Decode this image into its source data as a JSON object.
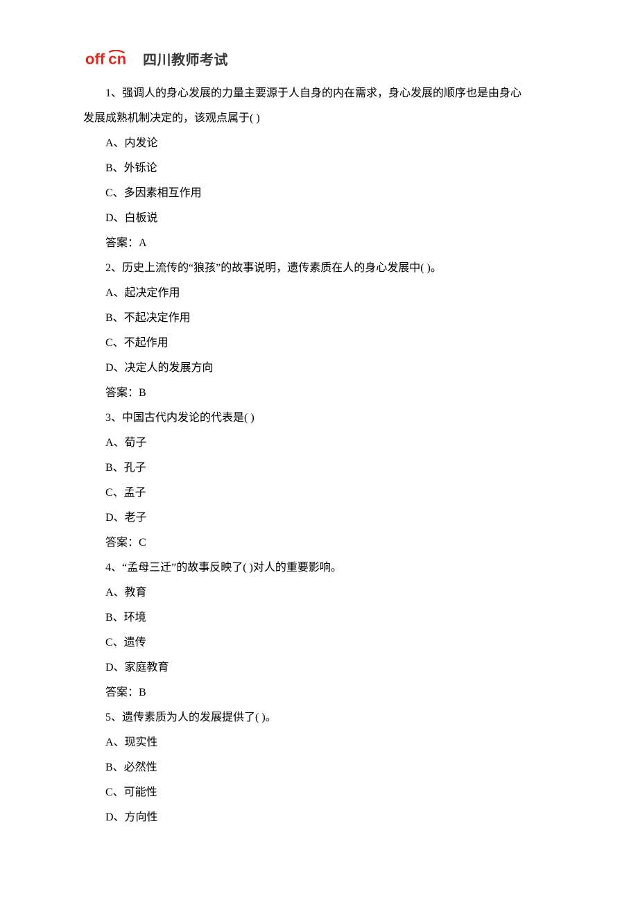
{
  "header": {
    "logo_brand": "offcn",
    "logo_title": "四川教师考试"
  },
  "questions": [
    {
      "stem": "1、强调人的身心发展的力量主要源于人自身的内在需求，身心发展的顺序也是由身心发展成熟机制决定的，该观点属于( )",
      "options": [
        "A、内发论",
        "B、外铄论",
        "C、多因素相互作用",
        "D、白板说"
      ],
      "answer": "答案：A"
    },
    {
      "stem": "2、历史上流传的“狼孩”的故事说明，遗传素质在人的身心发展中(    )。",
      "options": [
        "A、起决定作用",
        "B、不起决定作用",
        "C、不起作用",
        "D、决定人的发展方向"
      ],
      "answer": "答案：B"
    },
    {
      "stem": "3、中国古代内发论的代表是( )",
      "options": [
        "A、荀子",
        "B、孔子",
        "C、孟子",
        "D、老子"
      ],
      "answer": "答案：C"
    },
    {
      "stem": "4、“孟母三迁”的故事反映了(    )对人的重要影响。",
      "options": [
        "A、教育",
        "B、环境",
        "C、遗传",
        "D、家庭教育"
      ],
      "answer": "答案：B"
    },
    {
      "stem": "5、遗传素质为人的发展提供了(    )。",
      "options": [
        "A、现实性",
        "B、必然性",
        "C、可能性",
        "D、方向性"
      ],
      "answer": ""
    }
  ]
}
